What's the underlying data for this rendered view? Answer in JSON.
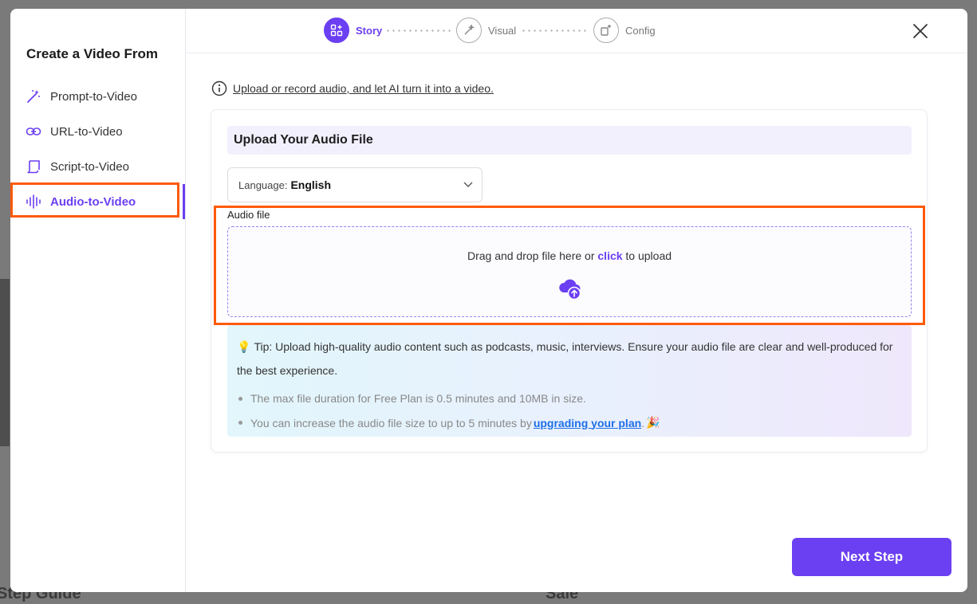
{
  "sidebar": {
    "title": "Create a Video From",
    "items": [
      {
        "label": "Prompt-to-Video",
        "icon": "magic-wand-icon"
      },
      {
        "label": "URL-to-Video",
        "icon": "link-icon"
      },
      {
        "label": "Script-to-Video",
        "icon": "scroll-icon"
      },
      {
        "label": "Audio-to-Video",
        "icon": "audio-wave-icon",
        "active": true
      }
    ]
  },
  "stepper": {
    "steps": [
      {
        "label": "Story",
        "icon": "story-icon",
        "active": true
      },
      {
        "label": "Visual",
        "icon": "visual-icon",
        "active": false
      },
      {
        "label": "Config",
        "icon": "config-icon",
        "active": false
      }
    ]
  },
  "info": {
    "text": "Upload or record audio, and let AI turn it into a video."
  },
  "card": {
    "title": "Upload Your Audio File",
    "language": {
      "label": "Language:",
      "value": "English"
    },
    "audio_label": "Audio file",
    "drop": {
      "before": "Drag and drop file here or ",
      "click": "click",
      "after": " to upload"
    },
    "tip": {
      "main": "Tip: Upload high-quality audio content such as podcasts, music, interviews. Ensure your audio file are clear and well-produced for the best experience.",
      "bullet1": "The max file duration for Free Plan is 0.5 minutes and 10MB in size.",
      "bullet2_before": "You can increase the audio file size to up to 5 minutes by ",
      "bullet2_link": "upgrading your plan",
      "bullet2_after": "."
    }
  },
  "footer": {
    "next_label": "Next Step"
  },
  "background": {
    "text1": "Step Guide",
    "text2": "Sale"
  },
  "colors": {
    "accent": "#6b3ff2",
    "highlight": "#ff5a0a",
    "link": "#1e6fe8"
  }
}
